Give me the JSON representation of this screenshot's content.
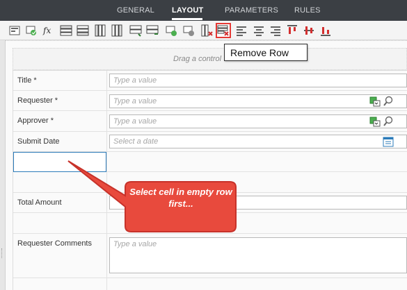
{
  "tabs": [
    {
      "label": "GENERAL",
      "active": false
    },
    {
      "label": "LAYOUT",
      "active": true
    },
    {
      "label": "PARAMETERS",
      "active": false
    },
    {
      "label": "RULES",
      "active": false
    }
  ],
  "toolbar": {
    "tooltip": "Remove Row",
    "buttons": [
      "properties-icon",
      "refresh-icon",
      "fx-icon",
      "insert-row-above-icon",
      "insert-row-below-icon",
      "insert-column-left-icon",
      "insert-column-right-icon",
      "merge-cells-icon",
      "split-cells-icon",
      "cut-icon",
      "paste-icon",
      "remove-column-icon",
      "remove-row-icon",
      "align-left-icon",
      "align-center-icon",
      "align-right-icon",
      "align-top-icon",
      "align-middle-icon",
      "align-bottom-icon"
    ]
  },
  "canvas": {
    "drop_hint": "Drag a control"
  },
  "form": {
    "rows": [
      {
        "label": "Title *",
        "placeholder": "Type a value",
        "control": "text"
      },
      {
        "label": "Requester *",
        "placeholder": "Type a value",
        "control": "people"
      },
      {
        "label": "Approver *",
        "placeholder": "Type a value",
        "control": "people"
      },
      {
        "label": "Submit Date",
        "placeholder": "Select a date",
        "control": "date"
      },
      {
        "label": "",
        "placeholder": "",
        "control": "empty-selected"
      },
      {
        "label": "",
        "placeholder": "",
        "control": "empty"
      },
      {
        "label": "Total Amount",
        "placeholder": "",
        "control": "text"
      },
      {
        "label": "",
        "placeholder": "",
        "control": "empty"
      },
      {
        "label": "Requester Comments",
        "placeholder": "Type a value",
        "control": "multiline"
      }
    ]
  },
  "callout": {
    "text": "Select cell in empty row first...",
    "fill": "#e84a3d",
    "border": "#c7322a"
  },
  "colors": {
    "tabbar": "#3b3f44",
    "selection": "#2b7bb9",
    "highlight": "#e53935"
  }
}
